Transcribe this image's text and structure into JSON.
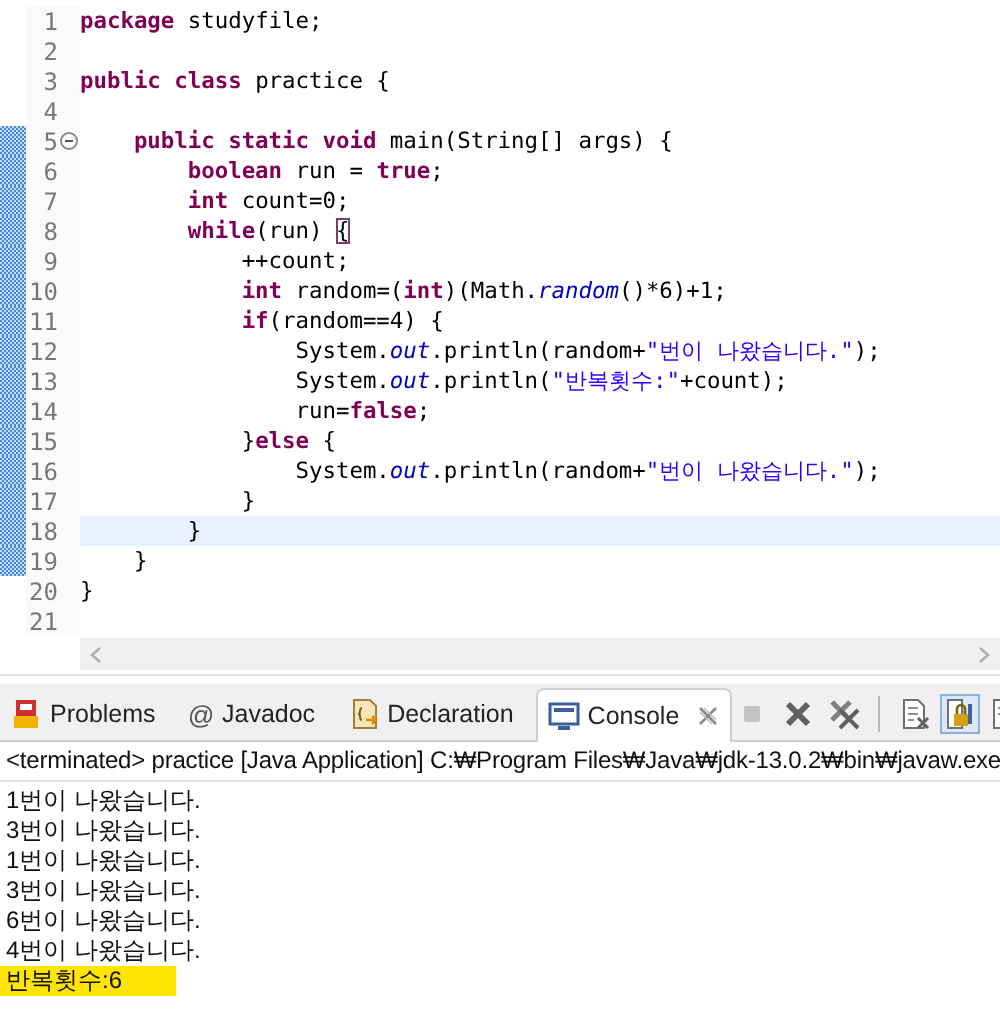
{
  "editor": {
    "lines": [
      {
        "number": "1",
        "tokens": [
          {
            "kind": "kw",
            "text": "package"
          },
          {
            "kind": "plain",
            "text": " studyfile;"
          }
        ]
      },
      {
        "number": "2"
      },
      {
        "number": "3",
        "tokens": [
          {
            "kind": "kw",
            "text": "public class"
          },
          {
            "kind": "plain",
            "text": " practice {"
          }
        ]
      },
      {
        "number": "4"
      },
      {
        "number": "5",
        "foldable": true,
        "in_range": true,
        "tokens": [
          {
            "kind": "kw",
            "text": "    public static void"
          },
          {
            "kind": "plain",
            "text": " main(String[] args) {"
          }
        ]
      },
      {
        "number": "6",
        "in_range": true,
        "tokens": [
          {
            "kind": "kw",
            "text": "        boolean"
          },
          {
            "kind": "plain",
            "text": " run = "
          },
          {
            "kind": "kw",
            "text": "true"
          },
          {
            "kind": "plain",
            "text": ";"
          }
        ]
      },
      {
        "number": "7",
        "in_range": true,
        "tokens": [
          {
            "kind": "kw",
            "text": "        int"
          },
          {
            "kind": "plain",
            "text": " count=0;"
          }
        ]
      },
      {
        "number": "8",
        "in_range": true,
        "tokens": [
          {
            "kind": "kw",
            "text": "        while"
          },
          {
            "kind": "plain",
            "text": "(run) "
          },
          {
            "kind": "match",
            "text": "{"
          }
        ]
      },
      {
        "number": "9",
        "in_range": true,
        "tokens": [
          {
            "kind": "plain",
            "text": "            ++count;"
          }
        ]
      },
      {
        "number": "10",
        "in_range": true,
        "tokens": [
          {
            "kind": "kw",
            "text": "            int"
          },
          {
            "kind": "plain",
            "text": " random=("
          },
          {
            "kind": "kw",
            "text": "int"
          },
          {
            "kind": "plain",
            "text": ")(Math."
          },
          {
            "kind": "static",
            "text": "random"
          },
          {
            "kind": "plain",
            "text": "()*6)+1;"
          }
        ]
      },
      {
        "number": "11",
        "in_range": true,
        "tokens": [
          {
            "kind": "kw",
            "text": "            if"
          },
          {
            "kind": "plain",
            "text": "(random==4) {"
          }
        ]
      },
      {
        "number": "12",
        "in_range": true,
        "tokens": [
          {
            "kind": "plain",
            "text": "                System."
          },
          {
            "kind": "static",
            "text": "out"
          },
          {
            "kind": "plain",
            "text": ".println(random+"
          },
          {
            "kind": "str",
            "text": "\"번이 나왔습니다.\""
          },
          {
            "kind": "plain",
            "text": ");"
          }
        ]
      },
      {
        "number": "13",
        "in_range": true,
        "tokens": [
          {
            "kind": "plain",
            "text": "                System."
          },
          {
            "kind": "static",
            "text": "out"
          },
          {
            "kind": "plain",
            "text": ".println("
          },
          {
            "kind": "str",
            "text": "\"반복횟수:\""
          },
          {
            "kind": "plain",
            "text": "+count);"
          }
        ]
      },
      {
        "number": "14",
        "in_range": true,
        "tokens": [
          {
            "kind": "plain",
            "text": "                run="
          },
          {
            "kind": "kw",
            "text": "false"
          },
          {
            "kind": "plain",
            "text": ";"
          }
        ]
      },
      {
        "number": "15",
        "in_range": true,
        "tokens": [
          {
            "kind": "plain",
            "text": "            }"
          },
          {
            "kind": "kw",
            "text": "else"
          },
          {
            "kind": "plain",
            "text": " {"
          }
        ]
      },
      {
        "number": "16",
        "in_range": true,
        "tokens": [
          {
            "kind": "plain",
            "text": "                System."
          },
          {
            "kind": "static",
            "text": "out"
          },
          {
            "kind": "plain",
            "text": ".println(random+"
          },
          {
            "kind": "str",
            "text": "\"번이 나왔습니다.\""
          },
          {
            "kind": "plain",
            "text": ");"
          }
        ]
      },
      {
        "number": "17",
        "in_range": true,
        "tokens": [
          {
            "kind": "plain",
            "text": "            }"
          }
        ]
      },
      {
        "number": "18",
        "in_range": true,
        "current": true,
        "tokens": [
          {
            "kind": "plain",
            "text": "        }"
          }
        ]
      },
      {
        "number": "19",
        "in_range": true,
        "tokens": [
          {
            "kind": "plain",
            "text": "    }"
          }
        ]
      },
      {
        "number": "20",
        "tokens": [
          {
            "kind": "plain",
            "text": "}"
          }
        ]
      },
      {
        "number": "21"
      }
    ]
  },
  "panel": {
    "tabs": [
      {
        "kind": "problems",
        "label": "Problems",
        "selected": false
      },
      {
        "kind": "javadoc",
        "icon": "@",
        "label": "Javadoc",
        "selected": false
      },
      {
        "kind": "declaration",
        "label": "Declaration",
        "selected": false
      },
      {
        "kind": "console",
        "label": "Console",
        "selected": true
      }
    ],
    "toolbar": [
      {
        "kind": "stop",
        "disabled": true
      },
      {
        "kind": "remove",
        "disabled": false
      },
      {
        "kind": "remove-all",
        "disabled": false
      },
      {
        "kind": "separator"
      },
      {
        "kind": "clear",
        "disabled": false
      },
      {
        "kind": "scroll-lock",
        "disabled": false,
        "pressed": true
      },
      {
        "kind": "word-wrap",
        "disabled": false,
        "pressed": false
      }
    ],
    "console": {
      "header": "<terminated> practice [Java Application] C:₩Program Files₩Java₩jdk-13.0.2₩bin₩javaw.exe",
      "output": [
        {
          "text": "1번이 나왔습니다.",
          "highlighted": false
        },
        {
          "text": "3번이 나왔습니다.",
          "highlighted": false
        },
        {
          "text": "1번이 나왔습니다.",
          "highlighted": false
        },
        {
          "text": "3번이 나왔습니다.",
          "highlighted": false
        },
        {
          "text": "6번이 나왔습니다.",
          "highlighted": false
        },
        {
          "text": "4번이 나왔습니다.",
          "highlighted": false
        },
        {
          "text": "반복횟수:6",
          "highlighted": true
        }
      ]
    }
  }
}
